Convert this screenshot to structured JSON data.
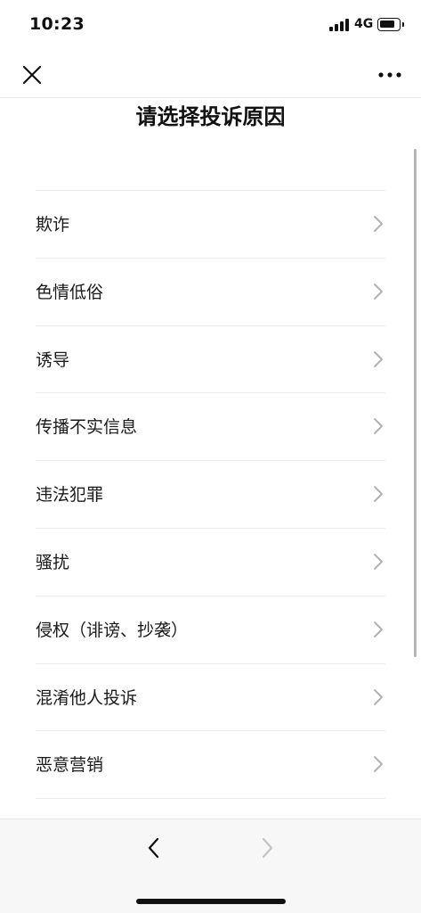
{
  "status_bar": {
    "time": "10:23",
    "network": "4G",
    "icons": [
      "signal-icon",
      "battery-icon"
    ]
  },
  "nav": {
    "close_icon": "close-icon",
    "more_icon": "more-icon"
  },
  "page": {
    "title": "请选择投诉原因"
  },
  "reasons": [
    {
      "label": "欺诈"
    },
    {
      "label": "色情低俗"
    },
    {
      "label": "诱导"
    },
    {
      "label": "传播不实信息"
    },
    {
      "label": "违法犯罪"
    },
    {
      "label": "骚扰"
    },
    {
      "label": "侵权（诽谤、抄袭）"
    },
    {
      "label": "混淆他人投诉"
    },
    {
      "label": "恶意营销"
    }
  ],
  "bottom_nav": {
    "back_icon": "chevron-left-icon",
    "forward_icon": "chevron-right-icon",
    "forward_enabled": false
  },
  "colors": {
    "text": "#111111",
    "divider": "#ececec",
    "chevron": "#b2b2b2",
    "bottom_bar": "#f7f7f7"
  }
}
